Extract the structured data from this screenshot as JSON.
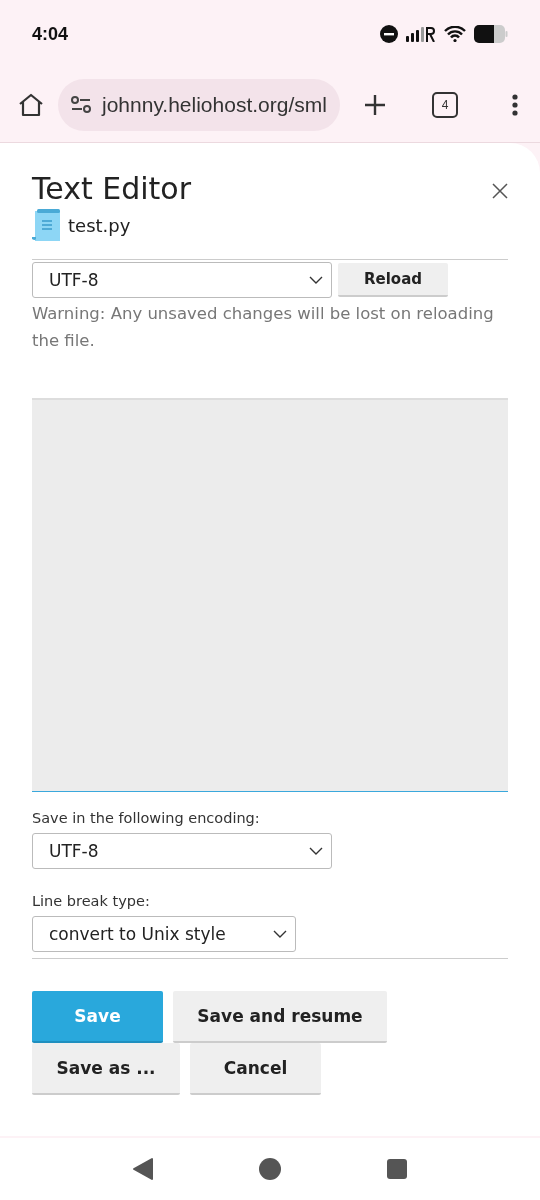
{
  "status_bar": {
    "time": "4:04"
  },
  "browser": {
    "url": "johnny.heliohost.org/sml",
    "tab_count": "4"
  },
  "dialog": {
    "title": "Text Editor",
    "file_name": "test.py",
    "load_encoding": {
      "value": "UTF-8"
    },
    "reload_button": "Reload",
    "warning": "Warning: Any unsaved changes will be lost on reloading the file.",
    "save_encoding": {
      "label": "Save in the following encoding:",
      "value": "UTF-8"
    },
    "line_break": {
      "label": "Line break type:",
      "value": "convert to Unix style"
    },
    "buttons": [
      {
        "label": "Save",
        "kind": "primary"
      },
      {
        "label": "Save and resume",
        "kind": "secondary"
      },
      {
        "label": "Save as ...",
        "kind": "secondary"
      },
      {
        "label": "Cancel",
        "kind": "secondary"
      }
    ]
  }
}
